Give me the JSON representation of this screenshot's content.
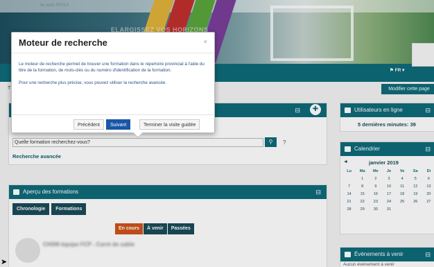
{
  "site": {
    "topbar_text": "Ilo earls RESUI"
  },
  "header": {
    "headline": "ELARGISSEZ VOS HORIZONS",
    "lang": "⚑ FR ▾",
    "edit_button": "Modifier cette page"
  },
  "tour": {
    "title": "Moteur de recherche",
    "close": "×",
    "paragraph1": "Le moteur de recherche permet de trouver une formation dans le répertoire provincial à l'aide du titre de la formation, de mots-clés ou du numéro d'identification de la formation.",
    "paragraph2": "Pour une recherche plus précise, vous pouvez utiliser la recherche avancée.",
    "prev": "Précédent",
    "next": "Suivant",
    "end": "Terminer la visite guidée"
  },
  "search": {
    "placeholder": "Quelle formation recherchez-vous?",
    "button_icon": "search-icon",
    "help": "?",
    "advanced": "Recherche avancée"
  },
  "left_label": "T",
  "overview": {
    "title": "Aperçu des formations",
    "tabs": [
      "Chronologie",
      "Formations"
    ],
    "filters": [
      "En cours",
      "À venir",
      "Passées"
    ],
    "course_title": "CHSM équipe FCP - Carré de sable"
  },
  "online": {
    "title": "Utilisateurs en ligne",
    "line": "5 dernières minutes: 39"
  },
  "calendar": {
    "title": "Calendrier",
    "prev": "◄",
    "month": "janvier 2019",
    "days": [
      "Lu",
      "Ma",
      "Me",
      "Je",
      "Ve",
      "Sa",
      "Di"
    ],
    "weeks": [
      [
        "",
        "1",
        "2",
        "3",
        "4",
        "5",
        "6"
      ],
      [
        "7",
        "8",
        "9",
        "10",
        "11",
        "12",
        "13"
      ],
      [
        "14",
        "15",
        "16",
        "17",
        "18",
        "19",
        "20"
      ],
      [
        "21",
        "22",
        "23",
        "24",
        "25",
        "26",
        "27"
      ],
      [
        "28",
        "29",
        "30",
        "31",
        "",
        "",
        ""
      ]
    ]
  },
  "events": {
    "title": "Événements à venir",
    "empty": "Aucun événement à venir"
  },
  "colors": {
    "teal": "#0f6b7a",
    "dark": "#1b4b5a",
    "orange": "#d0521a",
    "blue": "#1a56a8"
  }
}
